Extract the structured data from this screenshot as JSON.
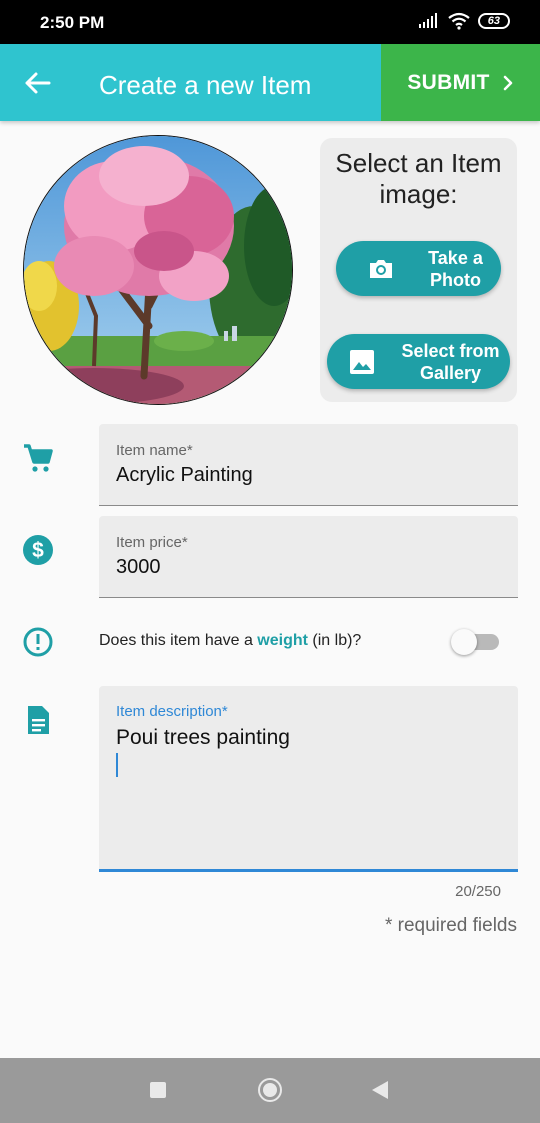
{
  "status_bar": {
    "time": "2:50 PM",
    "battery": "63"
  },
  "app_bar": {
    "title": "Create a new Item",
    "submit_label": "SUBMIT"
  },
  "image_picker": {
    "title": "Select an Item image:",
    "take_photo_label": "Take a Photo",
    "gallery_label": "Select from Gallery"
  },
  "form": {
    "name": {
      "label": "Item name*",
      "value": "Acrylic Painting"
    },
    "price": {
      "label": "Item price*",
      "value": "3000"
    },
    "weight": {
      "prefix": "Does this item have a ",
      "accent": "weight",
      "suffix": " (in lb)?",
      "enabled": false
    },
    "description": {
      "label": "Item description*",
      "value": "Poui trees painting",
      "counter": "20/250"
    },
    "required_note": "* required fields"
  },
  "colors": {
    "primary": "#2fc4cf",
    "submit": "#3cb54a",
    "accent": "#1f9fa6",
    "focus": "#2f88d6"
  },
  "icons": [
    "back-arrow-icon",
    "chevron-right-icon",
    "camera-icon",
    "image-icon",
    "cart-icon",
    "dollar-icon",
    "alert-circle-icon",
    "document-icon"
  ]
}
